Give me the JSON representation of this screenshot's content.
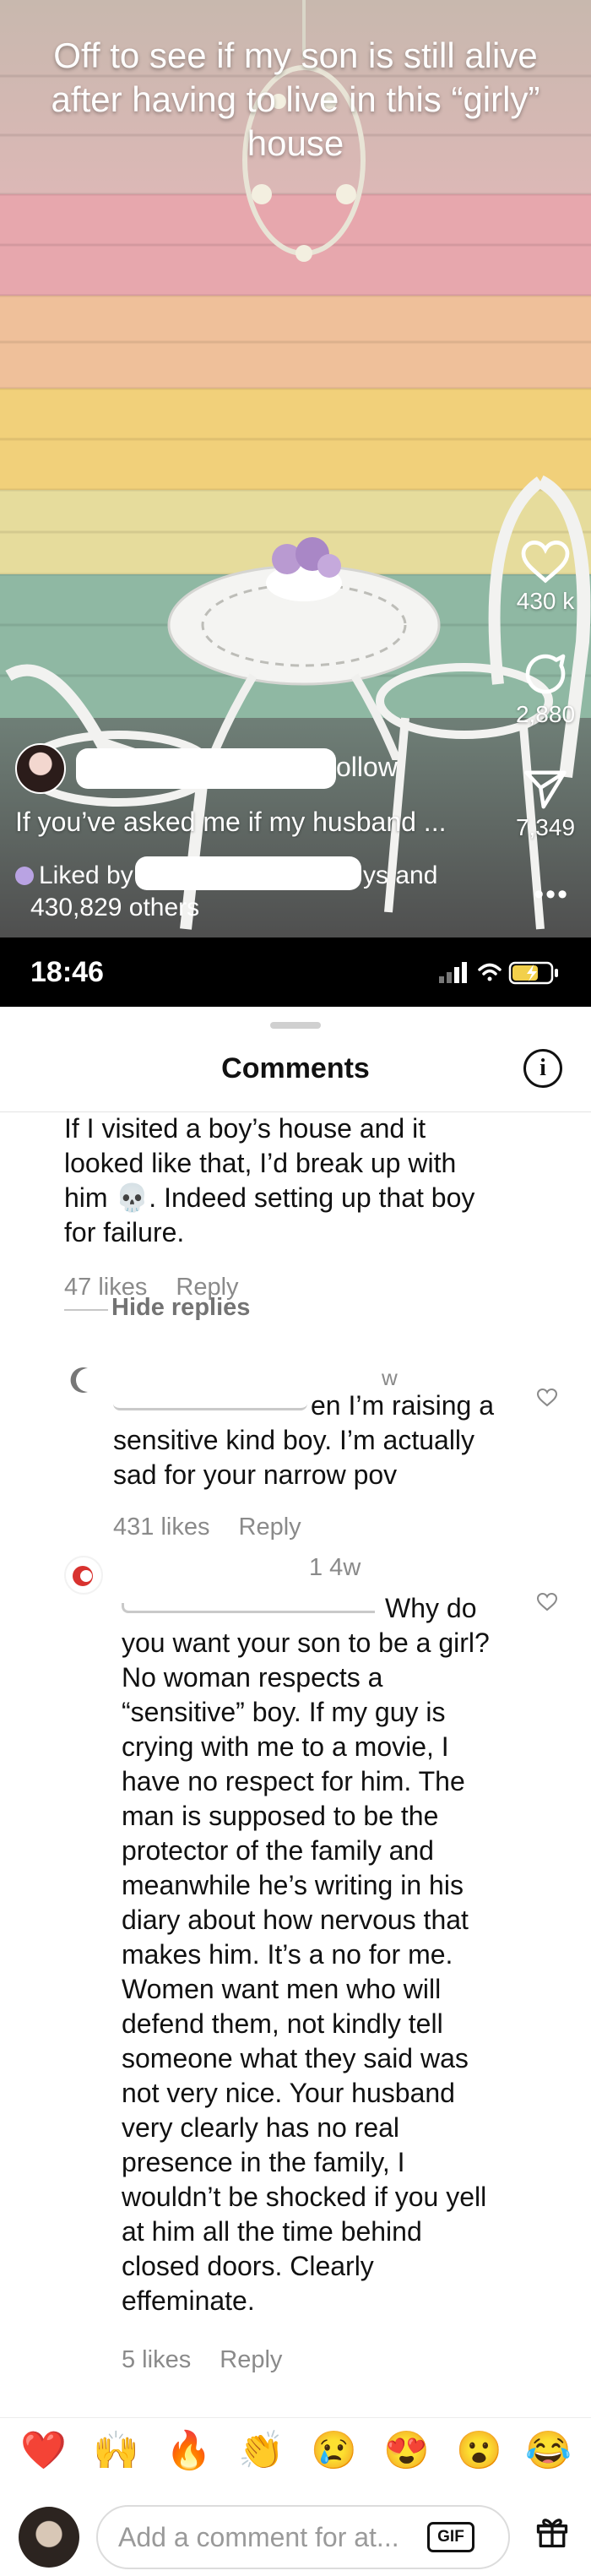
{
  "reel": {
    "overlay_text": "Off to see if my son is still alive after having to live in this “girly” house",
    "likes_count": "430 k",
    "comments_count": "2,880",
    "shares_count": "7,349",
    "follow_label": "ollow",
    "caption": "If you’ve asked me if my husband ...",
    "liked_by_prefix": "Liked by",
    "liked_by_suffix": "ys and",
    "liked_by_others": "430,829 others",
    "more_label": "•••"
  },
  "status_bar": {
    "time": "18:46"
  },
  "comments_sheet": {
    "title": "Comments",
    "info_label": "i",
    "hide_replies_label": "Hide replies",
    "comments": [
      {
        "lines": [
          "If I visited a boy’s house and it",
          "looked like that, I’d break up with",
          "him 💀. Indeed setting up that boy",
          "for failure."
        ],
        "likes": "47 likes",
        "reply": "Reply"
      },
      {
        "header_fragment": "w",
        "lines": [
          "en I’m raising a",
          "sensitive kind boy. I’m actually",
          "sad for your narrow pov"
        ],
        "likes": "431 likes",
        "reply": "Reply"
      },
      {
        "header_fragment": "1 4w",
        "lines": [
          "Why do",
          "you want your son to be a girl?",
          "No woman respects a",
          "“sensitive” boy. If my guy is",
          "crying with me to a movie, I",
          "have no respect for him. The",
          "man is supposed to be the",
          "protector of the family and",
          "meanwhile he’s writing in his",
          "diary about how nervous that",
          "makes him. It’s a no for me.",
          "Women want men who will",
          "defend them, not kindly tell",
          "someone what they said was",
          "not very nice. Your husband",
          "very clearly has no real",
          "presence in the family, I",
          "wouldn’t be shocked if you yell",
          "at him all the time behind",
          "closed doors. Clearly",
          "effeminate."
        ],
        "likes": "5 likes",
        "reply": "Reply"
      }
    ]
  },
  "emoji_bar": [
    "❤️",
    "🙌",
    "🔥",
    "👏",
    "😢",
    "😍",
    "😮",
    "😂"
  ],
  "composer": {
    "placeholder": "Add a comment for at...",
    "gif_label": "GIF"
  },
  "colors": {
    "stripe_pink": "#e9a6ac",
    "stripe_yellow": "#f1d07a",
    "stripe_green": "#8fb8a3",
    "liked_dot": "#b9a3e3"
  },
  "icons": [
    "heart-icon",
    "comment-icon",
    "send-icon",
    "more-icon",
    "info-icon",
    "gif-icon",
    "gift-icon",
    "skull-emoji"
  ]
}
